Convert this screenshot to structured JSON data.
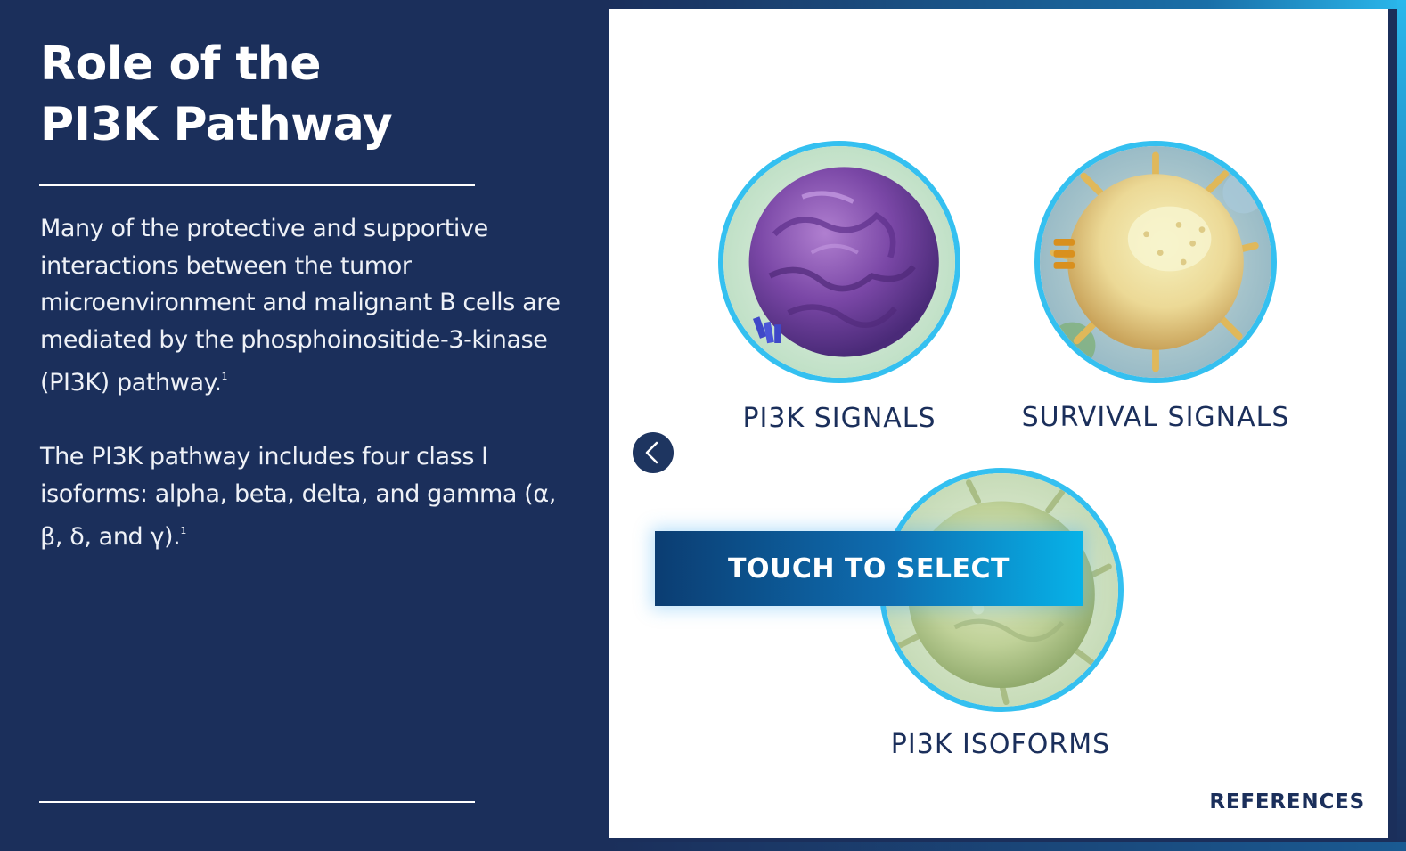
{
  "title": {
    "line1": "Role of the",
    "line2": "PI3K Pathway"
  },
  "paragraphs": {
    "p1_text": "Many of the protective and supportive interactions between the tumor microenvironment and malignant B cells are mediated by the phosphoinositide-3-kinase (PI3K) pathway.",
    "p1_ref": "1",
    "p2_text": "The PI3K pathway includes four class I isoforms: alpha, beta, delta, and gamma (α, β, δ, and γ).",
    "p2_ref": "1"
  },
  "cells": [
    {
      "label": "PI3K SIGNALS",
      "icon": "purple-b-cell-image"
    },
    {
      "label": "SURVIVAL SIGNALS",
      "icon": "yellow-stromal-cell-image"
    },
    {
      "label": "PI3K ISOFORMS",
      "icon": "green-cell-image"
    }
  ],
  "controls": {
    "back_icon": "chevron-left-icon",
    "touch_label": "TOUCH TO SELECT",
    "references_label": "REFERENCES"
  },
  "colors": {
    "navy": "#1b2f5b",
    "ring": "#34c0f0",
    "banner_start": "#0b3d72",
    "banner_end": "#07b2e8",
    "white": "#ffffff"
  }
}
